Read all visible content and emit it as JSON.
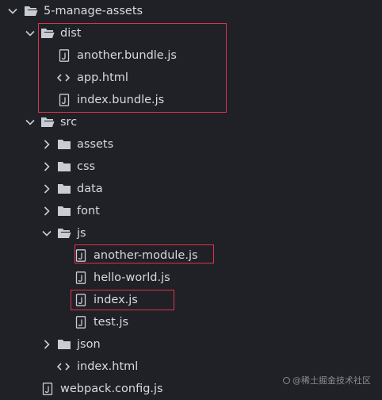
{
  "tree": {
    "items": [
      {
        "label": "5-manage-assets",
        "kind": "folder",
        "expanded": true,
        "depth": 0
      },
      {
        "label": "dist",
        "kind": "folder",
        "expanded": true,
        "depth": 1
      },
      {
        "label": "another.bundle.js",
        "kind": "js",
        "depth": 2
      },
      {
        "label": "app.html",
        "kind": "html",
        "depth": 2
      },
      {
        "label": "index.bundle.js",
        "kind": "js",
        "depth": 2
      },
      {
        "label": "src",
        "kind": "folder",
        "expanded": true,
        "depth": 1
      },
      {
        "label": "assets",
        "kind": "folder",
        "expanded": false,
        "depth": 2
      },
      {
        "label": "css",
        "kind": "folder",
        "expanded": false,
        "depth": 2
      },
      {
        "label": "data",
        "kind": "folder",
        "expanded": false,
        "depth": 2
      },
      {
        "label": "font",
        "kind": "folder",
        "expanded": false,
        "depth": 2
      },
      {
        "label": "js",
        "kind": "folder",
        "expanded": true,
        "depth": 2
      },
      {
        "label": "another-module.js",
        "kind": "js",
        "depth": 3
      },
      {
        "label": "hello-world.js",
        "kind": "js",
        "depth": 3
      },
      {
        "label": "index.js",
        "kind": "js",
        "depth": 3
      },
      {
        "label": "test.js",
        "kind": "js",
        "depth": 3
      },
      {
        "label": "json",
        "kind": "folder",
        "expanded": false,
        "depth": 2
      },
      {
        "label": "index.html",
        "kind": "html",
        "depth": 2
      },
      {
        "label": "webpack.config.js",
        "kind": "js",
        "depth": 1
      }
    ]
  },
  "watermark": {
    "text": "@稀土掘金技术社区"
  },
  "colors": {
    "background": "#1f2126",
    "text": "#d7dae0",
    "highlight": "#e0324b",
    "icon": "#c8ccd4"
  }
}
